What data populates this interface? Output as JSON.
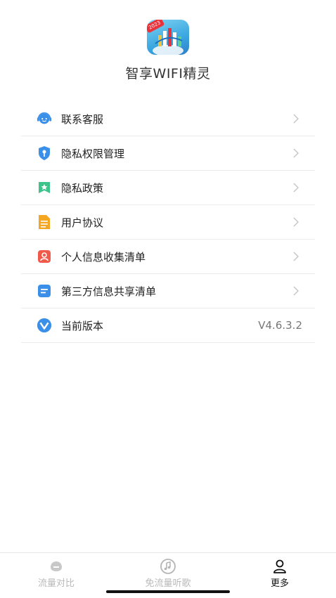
{
  "app": {
    "title": "智享WIFI精灵",
    "badge": "2023"
  },
  "menu": [
    {
      "label": "联系客服",
      "icon": "customer-service-icon"
    },
    {
      "label": "隐私权限管理",
      "icon": "shield-key-icon"
    },
    {
      "label": "隐私政策",
      "icon": "star-bookmark-icon"
    },
    {
      "label": "用户协议",
      "icon": "document-icon"
    },
    {
      "label": "个人信息收集清单",
      "icon": "person-card-icon"
    },
    {
      "label": "第三方信息共享清单",
      "icon": "list-card-icon"
    },
    {
      "label": "当前版本",
      "icon": "version-icon",
      "value": "V4.6.3.2"
    }
  ],
  "tabs": [
    {
      "label": "流量对比",
      "icon": "data-compare-icon",
      "active": false
    },
    {
      "label": "免流量听歌",
      "icon": "music-icon",
      "active": false
    },
    {
      "label": "更多",
      "icon": "person-icon",
      "active": true
    }
  ],
  "colors": {
    "accent": "#3a8fe8",
    "text": "#222222",
    "muted": "#b9b9b9"
  }
}
